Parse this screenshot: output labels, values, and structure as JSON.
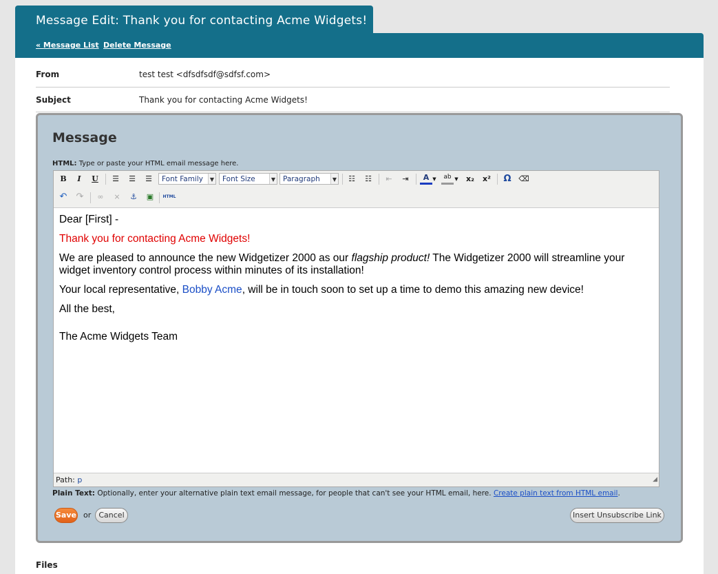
{
  "header": {
    "title": "Message Edit: Thank you for contacting Acme Widgets!",
    "nav": {
      "message_list": "« Message List",
      "delete_message": "Delete Message"
    }
  },
  "fields": {
    "from_label": "From",
    "from_value": "test test <dfsdfsdf@sdfsf.com>",
    "subject_label": "Subject",
    "subject_value": "Thank you for contacting Acme Widgets!"
  },
  "message": {
    "heading": "Message",
    "html_label": "HTML:",
    "html_hint": "Type or paste your HTML email message here.",
    "toolbar": {
      "bold": "B",
      "italic": "I",
      "underline": "U",
      "font_family": "Font Family",
      "font_size": "Font Size",
      "paragraph": "Paragraph",
      "subscript": "x₂",
      "superscript": "x²",
      "special_char": "Ω",
      "html_button": "HTML"
    },
    "body": {
      "greeting": "Dear [First] -",
      "thanks": "Thank you for contacting Acme Widgets!",
      "para1_a": "We are pleased to announce the new Widgetizer 2000 as our ",
      "para1_em": "flagship product!",
      "para1_b": " The Widgetizer 2000 will streamline your widget inventory control process within minutes of its installation!",
      "para2_a": "Your local representative, ",
      "para2_link": "Bobby Acme",
      "para2_b": ", will be in touch soon to set up a time to demo this amazing new device!",
      "closing": "All the best,",
      "signature": "The Acme Widgets Team"
    },
    "path_label": "Path:",
    "path_value": "p",
    "plain_label": "Plain Text:",
    "plain_hint": "Optionally, enter your alternative plain text email message, for people that can't see your HTML email, here.",
    "plain_link": "Create plain text from HTML email",
    "plain_end": ".",
    "save": "Save",
    "or": "or",
    "cancel": "Cancel",
    "unsubscribe": "Insert Unsubscribe Link"
  },
  "files_label": "Files",
  "colors": {
    "header": "#146f8a",
    "panel": "#b9cad6",
    "thanks": "#e00000",
    "link": "#1a4ec6",
    "save": "#e8681e"
  }
}
